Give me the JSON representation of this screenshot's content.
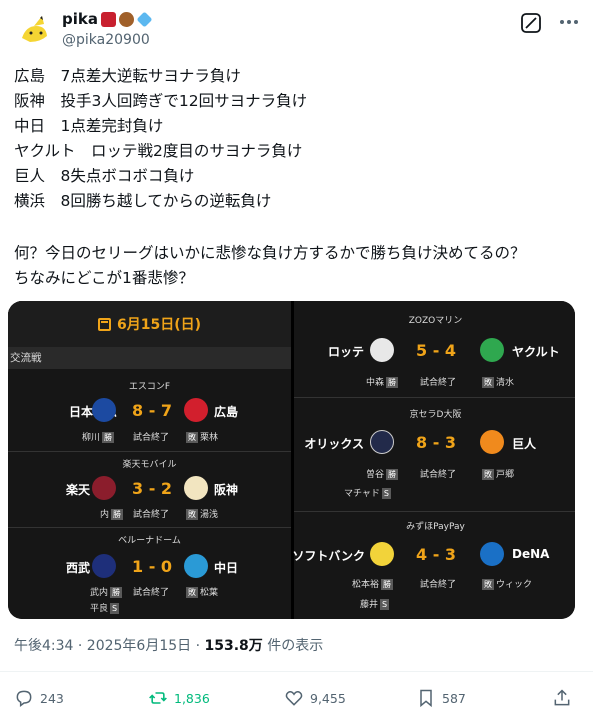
{
  "post": {
    "user": {
      "name": "pika",
      "handle": "@pika20900"
    },
    "lines": [
      "広島　7点差大逆転サヨナラ負け",
      "阪神　投手3人回跨ぎで12回サヨナラ負け",
      "中日　1点差完封負け",
      "ヤクルト　ロッテ戦2度目のサヨナラ負け",
      "巨人　8失点ボコボコ負け",
      "横浜　8回勝ち越してからの逆転負け"
    ],
    "question_lines": [
      "何？今日のセリーグはいかに悲惨な負け方するかで勝ち負け決めてるの？",
      "ちなみにどこが1番悲惨？"
    ]
  },
  "scoreboard": {
    "date": "6月15日(日)",
    "section": "交流戦",
    "final_label": "試合終了",
    "left_games": [
      {
        "venue": "エスコンF",
        "home": "日本ハム",
        "away": "広島",
        "score": "8 - 7",
        "win_pitcher": "柳川",
        "lose_pitcher": "栗林",
        "save_pitcher": "",
        "home_color": "#1c4aa1",
        "away_color": "#d21f2d"
      },
      {
        "venue": "楽天モバイル",
        "home": "楽天",
        "away": "阪神",
        "score": "3 - 2",
        "win_pitcher": "内",
        "lose_pitcher": "湯浅",
        "save_pitcher": "",
        "home_color": "#8b1d2c",
        "away_color": "#f2e5c0"
      },
      {
        "venue": "ベルーナドーム",
        "home": "西武",
        "away": "中日",
        "score": "1 - 0",
        "win_pitcher": "武内",
        "lose_pitcher": "松葉",
        "save_pitcher": "平良",
        "home_color": "#1e2f7a",
        "away_color": "#2a9ad6"
      }
    ],
    "right_games": [
      {
        "venue": "ZOZOマリン",
        "home": "ロッテ",
        "away": "ヤクルト",
        "score": "5 - 4",
        "win_pitcher": "中森",
        "lose_pitcher": "清水",
        "save_pitcher": "",
        "home_color": "#e8e8e8",
        "away_color": "#2fa84f"
      },
      {
        "venue": "京セラD大阪",
        "home": "オリックス",
        "away": "巨人",
        "score": "8 - 3",
        "win_pitcher": "曽谷",
        "lose_pitcher": "戸郷",
        "save_pitcher": "マチャド",
        "home_color": "#222a4a",
        "away_color": "#f08a1d"
      },
      {
        "venue": "みずほPayPay",
        "home": "ソフトバンク",
        "away": "DeNA",
        "score": "4 - 3",
        "win_pitcher": "松本裕",
        "lose_pitcher": "ウィック",
        "save_pitcher": "藤井",
        "home_color": "#f2d33a",
        "away_color": "#1a70c6"
      }
    ],
    "marks": {
      "win": "勝",
      "lose": "敗",
      "save": "S"
    }
  },
  "meta": {
    "time": "午後4:34 · 2025年6月15日 · ",
    "views": "153.8万",
    "views_suffix": " 件の表示"
  },
  "actions": {
    "replies": "243",
    "reposts": "1,836",
    "likes": "9,455",
    "bookmarks": "587"
  },
  "colors": {
    "accent_score": "#f0a419",
    "repost_green": "#00ba7c",
    "muted": "#536471"
  }
}
